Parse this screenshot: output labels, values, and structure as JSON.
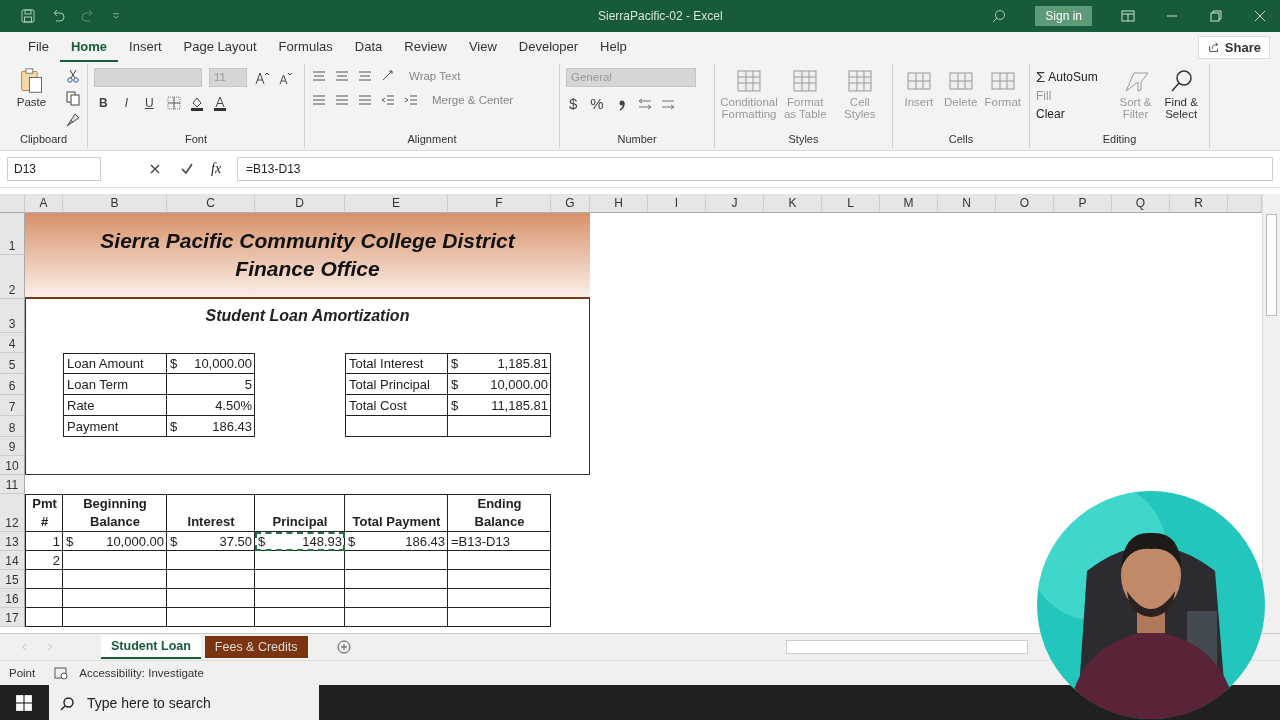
{
  "window": {
    "title": "SierraPacific-02  -  Excel",
    "sign_in": "Sign in"
  },
  "menu": [
    {
      "label": "File",
      "selected": false
    },
    {
      "label": "Home",
      "selected": true
    },
    {
      "label": "Insert",
      "selected": false
    },
    {
      "label": "Page Layout",
      "selected": false
    },
    {
      "label": "Formulas",
      "selected": false
    },
    {
      "label": "Data",
      "selected": false
    },
    {
      "label": "Review",
      "selected": false
    },
    {
      "label": "View",
      "selected": false
    },
    {
      "label": "Developer",
      "selected": false
    },
    {
      "label": "Help",
      "selected": false
    }
  ],
  "share": "Share",
  "ribbon": {
    "clipboard": {
      "paste": "Paste",
      "label": "Clipboard"
    },
    "font": {
      "size": "11",
      "bold": "B",
      "italic": "I",
      "underline": "U",
      "label": "Font"
    },
    "alignment": {
      "wrap": "Wrap Text",
      "merge": "Merge & Center",
      "label": "Alignment"
    },
    "number": {
      "format": "General",
      "currency": "$",
      "percent": "%",
      "label": "Number"
    },
    "styles": {
      "items": [
        {
          "label": "Conditional Formatting",
          "disabled": true
        },
        {
          "label": "Format as Table",
          "disabled": true
        },
        {
          "label": "Cell Styles",
          "disabled": true
        }
      ],
      "label": "Styles"
    },
    "cells": {
      "items": [
        {
          "label": "Insert",
          "disabled": true
        },
        {
          "label": "Delete",
          "disabled": true
        },
        {
          "label": "Format",
          "disabled": true
        }
      ],
      "label": "Cells"
    },
    "editing": {
      "sum_symbol": "Σ",
      "autosum": "AutoSum",
      "fill": "Fill",
      "clear": "Clear",
      "sort": "Sort & Filter",
      "find": "Find & Select",
      "label": "Editing"
    }
  },
  "formula_bar": {
    "name_box": "D13",
    "fx": "fx",
    "formula": "=B13-D13"
  },
  "sheet": {
    "columns": [
      "A",
      "B",
      "C",
      "D",
      "E",
      "F",
      "G",
      "H",
      "I",
      "J",
      "K",
      "L",
      "M",
      "N",
      "O",
      "P",
      "Q",
      "R"
    ],
    "rows": [
      "1",
      "2",
      "3",
      "4",
      "5",
      "6",
      "7",
      "8",
      "9",
      "10",
      "11",
      "12",
      "13",
      "14",
      "15",
      "16",
      "17"
    ],
    "title": [
      "Sierra Pacific Community College District",
      "Finance Office"
    ],
    "subtitle": "Student Loan Amortization",
    "inputs": [
      {
        "label": "Loan Amount",
        "currency": "$",
        "value": "10,000.00"
      },
      {
        "label": "Loan Term",
        "value": "5"
      },
      {
        "label": "Rate",
        "value": "4.50%"
      },
      {
        "label": "Payment",
        "currency": "$",
        "value": "186.43"
      }
    ],
    "totals": [
      {
        "label": "Total Interest",
        "currency": "$",
        "value": "1,185.81"
      },
      {
        "label": "Total Principal",
        "currency": "$",
        "value": "10,000.00"
      },
      {
        "label": "Total Cost",
        "currency": "$",
        "value": "11,185.81"
      }
    ],
    "schedule": {
      "headers": [
        "Pmt #",
        "Beginning\nBalance",
        "Interest",
        "Principal",
        "Total Payment",
        "Ending\nBalance"
      ],
      "rows": [
        [
          {
            "value": "1",
            "marquee": false
          },
          {
            "currency": "$",
            "value": "10,000.00",
            "marquee": false
          },
          {
            "currency": "$",
            "value": "37.50",
            "marquee": false
          },
          {
            "currency": "$",
            "value": "148.93",
            "marquee": true
          },
          {
            "currency": "$",
            "value": "186.43",
            "marquee": false
          },
          {
            "value": "=B13-D13",
            "marquee": false
          }
        ],
        [
          {
            "value": "2",
            "marquee": false
          }
        ]
      ]
    }
  },
  "sheet_tabs": [
    {
      "label": "Student Loan",
      "selected": true
    },
    {
      "label": "Fees & Credits",
      "selected": false,
      "color": "#7b3410"
    }
  ],
  "status_bar": {
    "mode": "Point",
    "accessibility": "Accessibility: Investigate"
  },
  "taskbar": {
    "search_placeholder": "Type here to search"
  }
}
